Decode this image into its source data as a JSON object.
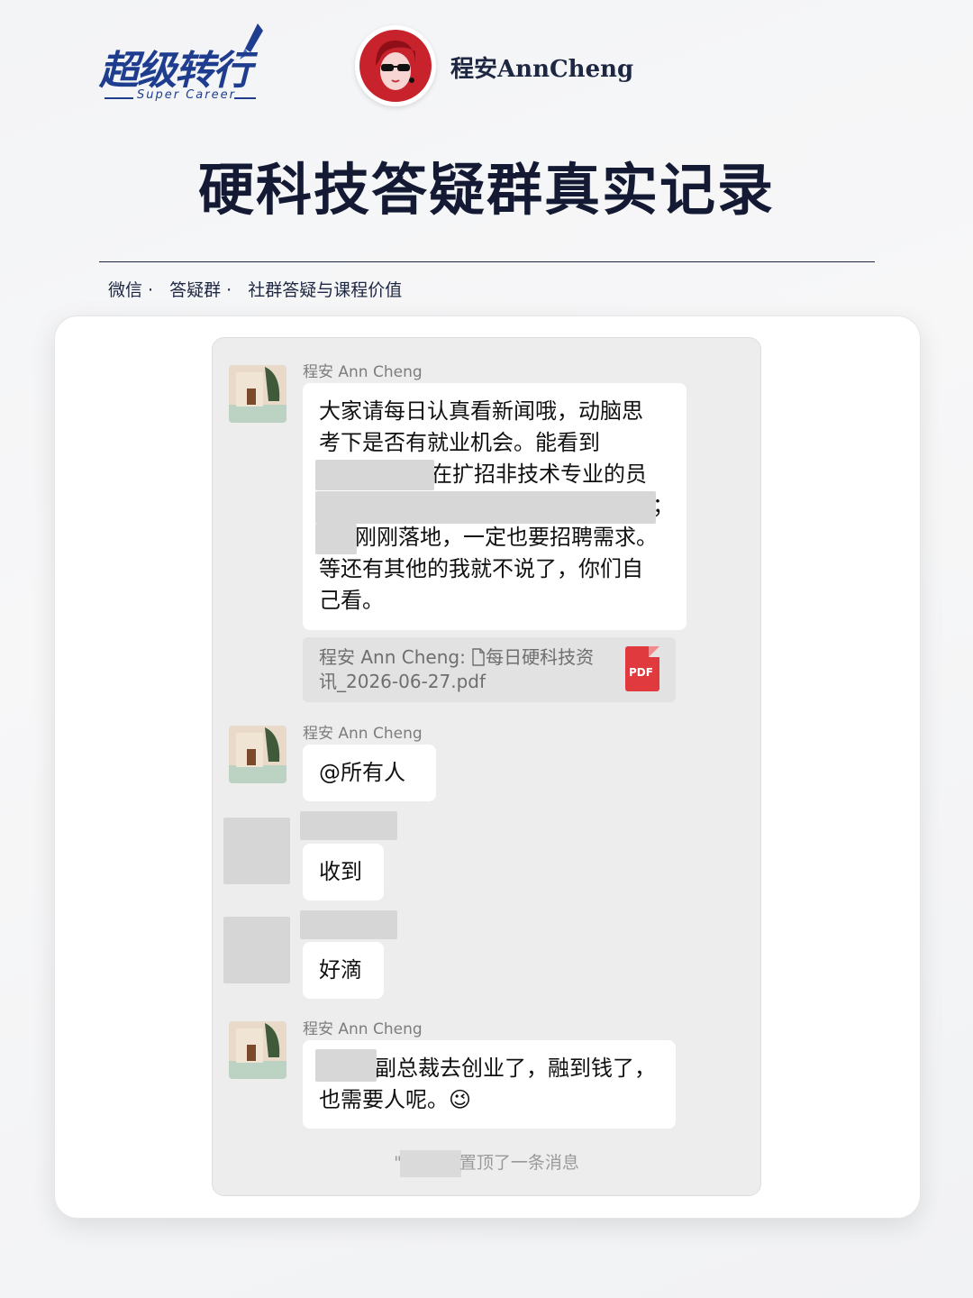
{
  "brand": {
    "logo_text": "超级转行",
    "logo_subtitle": "Super Career"
  },
  "author": {
    "name": "程安AnnCheng"
  },
  "title": "硬科技答疑群真实记录",
  "tags": [
    "微信 ·",
    "答疑群 ·",
    "社群答疑与课程价值"
  ],
  "chat": {
    "messages": [
      {
        "sender": "程安 Ann Cheng",
        "lines": [
          "大家请每日认真看新闻哦，动脑思",
          "考下是否有就业机会。能看到",
          "在扩招非技术专业的员",
          "；",
          "刚刚落地，一定也要招聘需求。",
          "等还有其他的我就不说了，你们自",
          "己看。"
        ]
      },
      {
        "file_prefix": "程安 Ann Cheng:",
        "file_name_line1": "每日硬科技资",
        "file_name_line2": "讯_2026-06-27.pdf",
        "file_badge": "PDF"
      },
      {
        "sender": "程安 Ann Cheng",
        "text": "@所有人"
      },
      {
        "sender": "",
        "text": "收到"
      },
      {
        "sender": "",
        "text": "好滴"
      },
      {
        "sender": "程安 Ann Cheng",
        "lines": [
          "副总裁去创业了，融到钱了，",
          "也需要人呢。😉"
        ]
      }
    ],
    "system_note_prefix": "\"",
    "system_note_suffix": "置顶了一条消息"
  },
  "colors": {
    "brand_blue": "#1f3d8f",
    "title_navy": "#141a33",
    "pdf_red": "#e0393e"
  }
}
